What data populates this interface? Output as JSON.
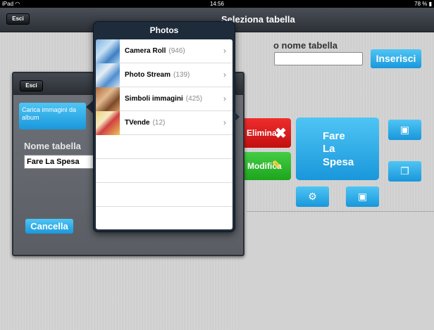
{
  "status_bar": {
    "device": "iPad",
    "time": "14:56",
    "battery": "78 %"
  },
  "navbar": {
    "exit_label": "Esci",
    "title": "Seleziona tabella"
  },
  "right_form": {
    "name_label": "o nome tabella",
    "name_value": "",
    "insert_label": "Inserisci"
  },
  "actions": {
    "delete_label": "Elimina",
    "edit_label": "Modifica"
  },
  "tile": {
    "line1": "Fare",
    "line2": "La",
    "line3": "Spesa"
  },
  "left_panel": {
    "exit_label": "Esci",
    "load_button": "Carica immagini da album",
    "name_label": "Nome tabella",
    "name_value": "Fare La Spesa",
    "cancel_label": "Cancella"
  },
  "photos_popover": {
    "title": "Photos",
    "albums": [
      {
        "name": "Camera Roll",
        "count": "(946)"
      },
      {
        "name": "Photo Stream",
        "count": "(139)"
      },
      {
        "name": "Simboli immagini",
        "count": "(425)"
      },
      {
        "name": "TVende",
        "count": "(12)"
      }
    ]
  },
  "icons": {
    "wifi": "wifi-icon",
    "battery": "battery-icon",
    "chevron": "chevron-right-icon",
    "delete": "x-icon",
    "edit": "pencil-icon",
    "gear": "gear-icon",
    "contact": "person-card-icon",
    "copy": "document-icon"
  },
  "colors": {
    "accent_blue": "#1a98dc",
    "delete_red": "#d01b1b",
    "edit_green": "#2cb52c",
    "popover_dark": "#1e2b3a"
  }
}
